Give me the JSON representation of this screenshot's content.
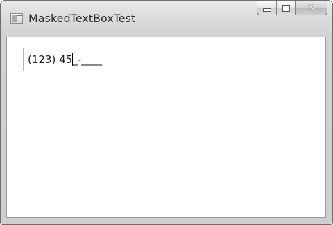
{
  "window": {
    "title": "MaskedTextBoxTest",
    "app_icon": "window-app-icon"
  },
  "caption_buttons": {
    "minimize_icon": "minimize-icon",
    "maximize_icon": "maximize-icon",
    "close_icon": "close-icon",
    "close_glyph": "✕"
  },
  "masked_textbox": {
    "text_before_caret": "(123) 45",
    "text_after_caret": "_-____"
  }
}
